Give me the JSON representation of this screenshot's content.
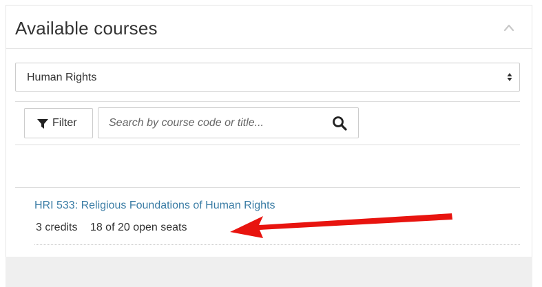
{
  "panel": {
    "title": "Available courses",
    "collapse_icon": "chevron-up-icon"
  },
  "program_select": {
    "value": "Human Rights",
    "caret_icon": "sort-caret-icon"
  },
  "toolbar": {
    "filter_label": "Filter",
    "filter_icon": "funnel-icon",
    "search_placeholder": "Search by course code or title...",
    "search_value": "",
    "search_icon": "magnifier-icon"
  },
  "courses": [
    {
      "title": "HRI 533: Religious Foundations of Human Rights",
      "credits": "3 credits",
      "seats": "18 of 20 open seats"
    }
  ],
  "annotation": {
    "color": "#e8140f",
    "icon": "red-arrow-annotation"
  },
  "colors": {
    "link": "#3a7ca5",
    "text": "#333333",
    "border": "#cccccc",
    "page_gray": "#efefef"
  }
}
